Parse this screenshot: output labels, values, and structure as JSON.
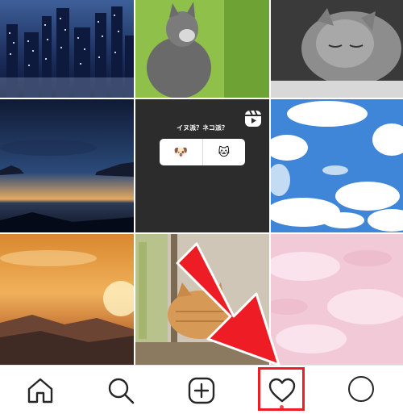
{
  "feed": {
    "posts": [
      {
        "name": "post-city-night"
      },
      {
        "name": "post-kitten-looking-up"
      },
      {
        "name": "post-cat-sleeping"
      },
      {
        "name": "post-sunset-lake"
      },
      {
        "name": "post-poll-reel"
      },
      {
        "name": "post-blue-sky-clouds"
      },
      {
        "name": "post-orange-sunset"
      },
      {
        "name": "post-cat-hiding"
      },
      {
        "name": "post-pink-clouds"
      }
    ],
    "poll_post": {
      "question": "イヌ派？ネコ派？",
      "option_left": "🐶",
      "option_right": "🐱",
      "badge_icon": "reels-icon"
    }
  },
  "navbar": {
    "items": [
      {
        "id": "home",
        "icon": "home-icon"
      },
      {
        "id": "search",
        "icon": "search-icon"
      },
      {
        "id": "create",
        "icon": "plus-square-icon"
      },
      {
        "id": "activity",
        "icon": "heart-icon",
        "has_notification": true
      },
      {
        "id": "profile",
        "icon": "avatar"
      }
    ]
  },
  "annotation": {
    "color": "#ee1c25",
    "target": "activity"
  }
}
